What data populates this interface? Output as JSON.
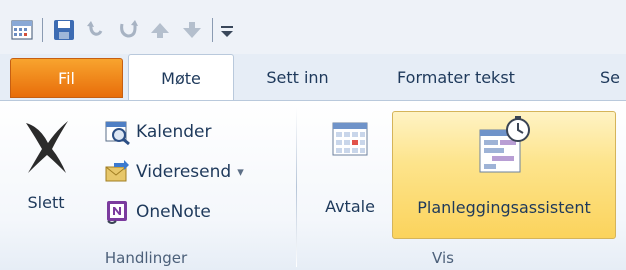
{
  "tabs": [
    "Fil",
    "Møte",
    "Sett inn",
    "Formater tekst",
    "Se"
  ],
  "groups": {
    "handlinger": {
      "label": "Handlinger",
      "slett": "Slett",
      "kalender": "Kalender",
      "videresend": "Videresend",
      "onenote": "OneNote"
    },
    "vis": {
      "label": "Vis",
      "avtale": "Avtale",
      "planlegging": "Planleggingsassistent"
    }
  },
  "qat": {
    "icons": [
      "calendar-icon",
      "save-icon",
      "undo-icon",
      "redo-icon",
      "up-arrow-icon",
      "down-arrow-icon",
      "customize-icon"
    ]
  },
  "colors": {
    "file_tab": "#e86d0a",
    "selected_button": "#fbd35c",
    "text": "#1e395b"
  },
  "dropdown_glyph": "▾"
}
